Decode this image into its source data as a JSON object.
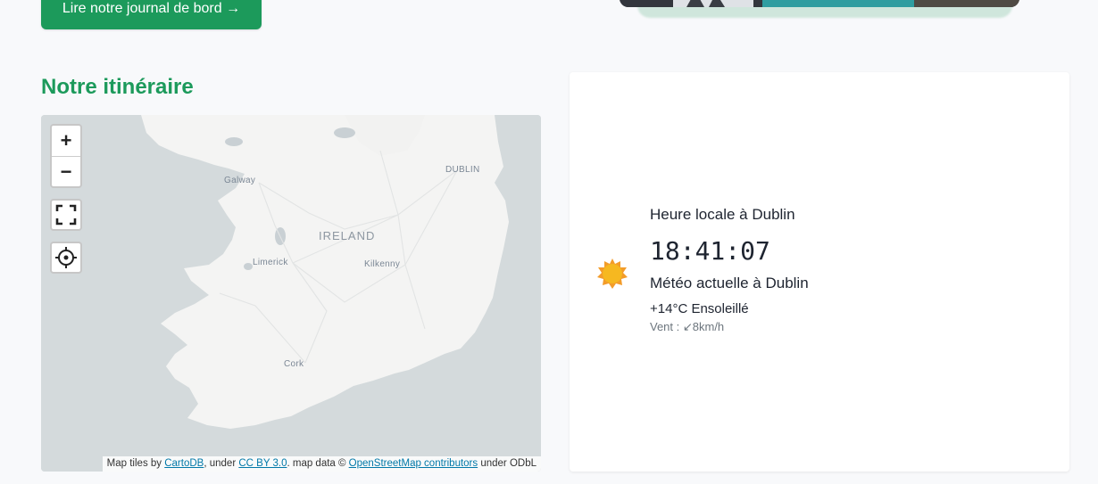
{
  "cta": {
    "label": "Lire notre journal de bord →"
  },
  "section": {
    "title": "Notre itinéraire"
  },
  "map": {
    "zoom_in": "+",
    "zoom_out": "−",
    "labels": {
      "country": "IRELAND",
      "dublin": "DUBLIN",
      "galway": "Galway",
      "limerick": "Limerick",
      "kilkenny": "Kilkenny",
      "cork": "Cork"
    },
    "attribution": {
      "prefix": "Map tiles by ",
      "cartodb": "CartoDB",
      "under1": ", under ",
      "ccby": "CC BY 3.0",
      "mapdata": ". map data © ",
      "osm": "OpenStreetMap contributors",
      "under2": " under ODbL"
    }
  },
  "weather": {
    "time_label": "Heure locale à Dublin",
    "clock": "18:41:07",
    "weather_label": "Météo actuelle à Dublin",
    "temp": "+14°C Ensoleillé",
    "wind": "Vent : ↙8km/h",
    "icon": "sun-icon"
  },
  "colors": {
    "accent": "#1c9a5b",
    "link": "#0078a8"
  }
}
